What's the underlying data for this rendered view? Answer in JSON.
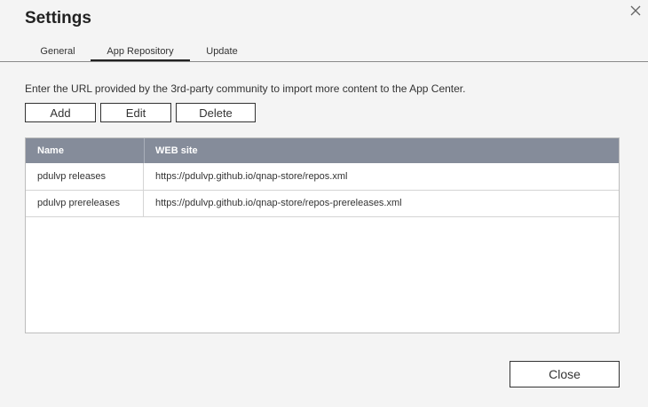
{
  "dialog": {
    "title": "Settings",
    "close_icon": "close-icon"
  },
  "tabs": [
    {
      "label": "General",
      "active": false
    },
    {
      "label": "App Repository",
      "active": true
    },
    {
      "label": "Update",
      "active": false
    }
  ],
  "description": "Enter the URL provided by the 3rd-party community to import more content to the App Center.",
  "toolbar": {
    "add_label": "Add",
    "edit_label": "Edit",
    "delete_label": "Delete"
  },
  "table": {
    "columns": [
      "Name",
      "WEB site"
    ],
    "rows": [
      {
        "name": "pdulvp releases",
        "url": "https://pdulvp.github.io/qnap-store/repos.xml"
      },
      {
        "name": "pdulvp prereleases",
        "url": "https://pdulvp.github.io/qnap-store/repos-prereleases.xml"
      }
    ],
    "header_color": "#858c9a"
  },
  "footer": {
    "close_label": "Close"
  }
}
